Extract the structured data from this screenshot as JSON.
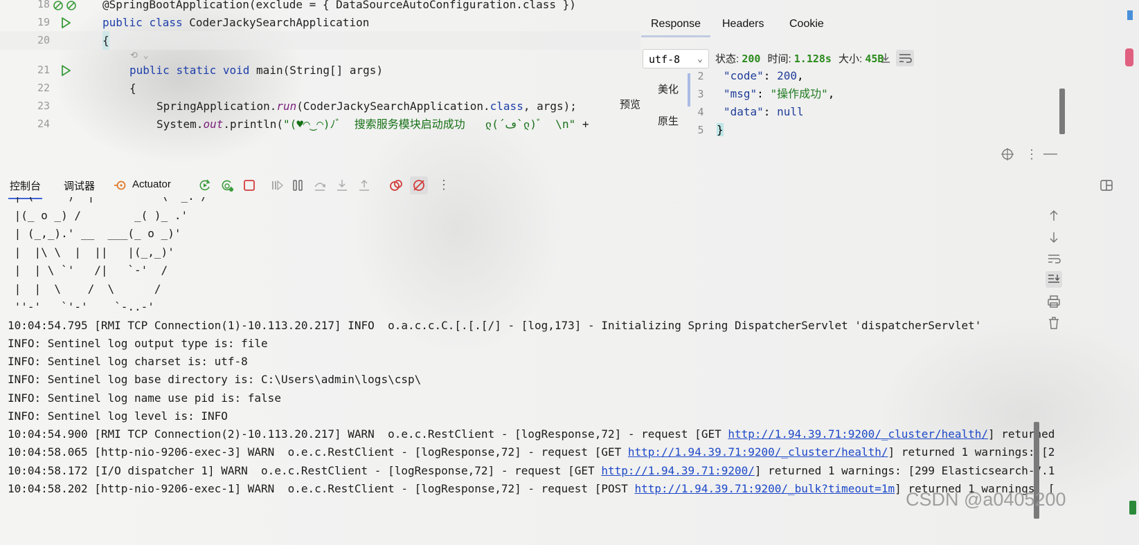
{
  "editor": {
    "lines": [
      {
        "num": "18",
        "text": "@SpringBootApplication(exclude = { DataSourceAutoConfiguration.class })"
      },
      {
        "num": "19",
        "kw1": "public",
        "kw2": "class",
        "name": "CoderJackySearchApplication"
      },
      {
        "num": "20",
        "text": "{"
      },
      {
        "num": "21",
        "kw1": "public",
        "kw2": "static",
        "kw3": "void",
        "rest": "main(String[] args)"
      },
      {
        "num": "22",
        "text": "{"
      },
      {
        "num": "23",
        "pre": "SpringApplication.",
        "method": "run",
        "mid": "(CoderJackySearchApplication.",
        "kw": "class",
        "post": ", args);"
      },
      {
        "num": "24",
        "pre": "System.",
        "field": "out",
        "mid": ".println(",
        "str": "\"(♥◠‿◠)ﾉﾞ  搜索服务模块启动成功   ლ(´ڡ`ლ)ﾞ  \\n\"",
        "post": " +"
      }
    ],
    "inlay_hint": "⟲ ⌄"
  },
  "response": {
    "tabs": [
      "Response",
      "Headers",
      "Cookie"
    ],
    "active_tab": "Response",
    "encoding": "utf-8",
    "status_label": "状态:",
    "status_value": "200",
    "time_label": "时间:",
    "time_value": "1.128s",
    "size_label": "大小:",
    "size_value": "45B",
    "view_group_label": "预览",
    "view_pretty": "美化",
    "view_raw": "原生",
    "json_lines": [
      {
        "num": "2",
        "key": "\"code\"",
        "sep": ": ",
        "value": "200",
        "tail": ","
      },
      {
        "num": "3",
        "key": "\"msg\"",
        "sep": ": ",
        "value": "\"操作成功\"",
        "tail": ","
      },
      {
        "num": "4",
        "key": "\"data\"",
        "sep": ": ",
        "value": "null",
        "tail": ""
      },
      {
        "num": "5",
        "brace": "}"
      }
    ]
  },
  "tool_window": {
    "tabs": [
      "控制台",
      "调试器",
      "Actuator"
    ],
    "active_tab": "控制台"
  },
  "console": {
    "ascii_art": [
      " | (     )  |          \\  _. /",
      " |(_ o _) /        _( )_ .'",
      " | (_,_).' __  ___(_ o _)'",
      " |  |\\ \\  |  ||   |(_,_)'",
      " |  | \\ `'   /|   `-'  /",
      " |  |  \\    /  \\      /",
      " ''-'   `'-'    `-..-'"
    ],
    "log_lines": [
      {
        "text": "10:04:54.795 [RMI TCP Connection(1)-10.113.20.217] INFO  o.a.c.c.C.[.[.[/] - [log,173] - Initializing Spring DispatcherServlet 'dispatcherServlet'"
      },
      {
        "text": "INFO: Sentinel log output type is: file"
      },
      {
        "text": "INFO: Sentinel log charset is: utf-8"
      },
      {
        "text": "INFO: Sentinel log base directory is: C:\\Users\\admin\\logs\\csp\\"
      },
      {
        "text": "INFO: Sentinel log name use pid is: false"
      },
      {
        "text": "INFO: Sentinel log level is: INFO"
      },
      {
        "pre": "10:04:54.900 [RMI TCP Connection(2)-10.113.20.217] WARN  o.e.c.RestClient - [logResponse,72] - request [GET ",
        "link": "http://1.94.39.71:9200/_cluster/health/",
        "post": "] returned"
      },
      {
        "pre": "10:04:58.065 [http-nio-9206-exec-3] WARN  o.e.c.RestClient - [logResponse,72] - request [GET ",
        "link": "http://1.94.39.71:9200/_cluster/health/",
        "post": "] returned 1 warnings: [2"
      },
      {
        "pre": "10:04:58.172 [I/O dispatcher 1] WARN  o.e.c.RestClient - [logResponse,72] - request [GET ",
        "link": "http://1.94.39.71:9200/",
        "post": "] returned 1 warnings: [299 Elasticsearch-7.1"
      },
      {
        "pre": "10:04:58.202 [http-nio-9206-exec-1] WARN  o.e.c.RestClient - [logResponse,72] - request [POST ",
        "link": "http://1.94.39.71:9200/_bulk?timeout=1m",
        "post": "] returned 1 warnings: ["
      }
    ]
  },
  "watermark": "CSDN @a0405200",
  "colors": {
    "run_green": "#3a9a3a",
    "stop_red": "#d23b3b",
    "accent_blue": "#3f64d6",
    "status_green": "#2a8a1a",
    "link_blue": "#1c48c8"
  }
}
